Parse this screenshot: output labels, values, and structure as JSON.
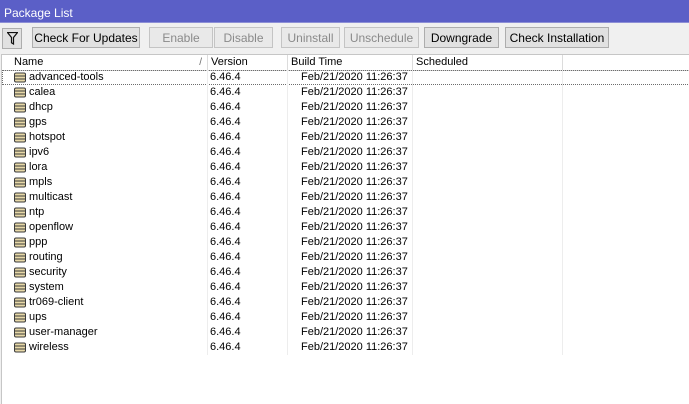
{
  "window": {
    "title": "Package List"
  },
  "toolbar": {
    "filter_icon": "filter-icon",
    "buttons": [
      {
        "label": "Check For Updates",
        "enabled": true
      },
      {
        "label": "Enable",
        "enabled": false
      },
      {
        "label": "Disable",
        "enabled": false
      },
      {
        "label": "Uninstall",
        "enabled": false
      },
      {
        "label": "Unschedule",
        "enabled": false
      },
      {
        "label": "Downgrade",
        "enabled": true
      },
      {
        "label": "Check Installation",
        "enabled": true
      }
    ]
  },
  "table": {
    "columns": [
      "Name",
      "Version",
      "Build Time",
      "Scheduled"
    ],
    "rows": [
      {
        "name": "advanced-tools",
        "version": "6.46.4",
        "build_time": "Feb/21/2020 11:26:37",
        "scheduled": ""
      },
      {
        "name": "calea",
        "version": "6.46.4",
        "build_time": "Feb/21/2020 11:26:37",
        "scheduled": ""
      },
      {
        "name": "dhcp",
        "version": "6.46.4",
        "build_time": "Feb/21/2020 11:26:37",
        "scheduled": ""
      },
      {
        "name": "gps",
        "version": "6.46.4",
        "build_time": "Feb/21/2020 11:26:37",
        "scheduled": ""
      },
      {
        "name": "hotspot",
        "version": "6.46.4",
        "build_time": "Feb/21/2020 11:26:37",
        "scheduled": ""
      },
      {
        "name": "ipv6",
        "version": "6.46.4",
        "build_time": "Feb/21/2020 11:26:37",
        "scheduled": ""
      },
      {
        "name": "lora",
        "version": "6.46.4",
        "build_time": "Feb/21/2020 11:26:37",
        "scheduled": ""
      },
      {
        "name": "mpls",
        "version": "6.46.4",
        "build_time": "Feb/21/2020 11:26:37",
        "scheduled": ""
      },
      {
        "name": "multicast",
        "version": "6.46.4",
        "build_time": "Feb/21/2020 11:26:37",
        "scheduled": ""
      },
      {
        "name": "ntp",
        "version": "6.46.4",
        "build_time": "Feb/21/2020 11:26:37",
        "scheduled": ""
      },
      {
        "name": "openflow",
        "version": "6.46.4",
        "build_time": "Feb/21/2020 11:26:37",
        "scheduled": ""
      },
      {
        "name": "ppp",
        "version": "6.46.4",
        "build_time": "Feb/21/2020 11:26:37",
        "scheduled": ""
      },
      {
        "name": "routing",
        "version": "6.46.4",
        "build_time": "Feb/21/2020 11:26:37",
        "scheduled": ""
      },
      {
        "name": "security",
        "version": "6.46.4",
        "build_time": "Feb/21/2020 11:26:37",
        "scheduled": ""
      },
      {
        "name": "system",
        "version": "6.46.4",
        "build_time": "Feb/21/2020 11:26:37",
        "scheduled": ""
      },
      {
        "name": "tr069-client",
        "version": "6.46.4",
        "build_time": "Feb/21/2020 11:26:37",
        "scheduled": ""
      },
      {
        "name": "ups",
        "version": "6.46.4",
        "build_time": "Feb/21/2020 11:26:37",
        "scheduled": ""
      },
      {
        "name": "user-manager",
        "version": "6.46.4",
        "build_time": "Feb/21/2020 11:26:37",
        "scheduled": ""
      },
      {
        "name": "wireless",
        "version": "6.46.4",
        "build_time": "Feb/21/2020 11:26:37",
        "scheduled": ""
      }
    ]
  }
}
